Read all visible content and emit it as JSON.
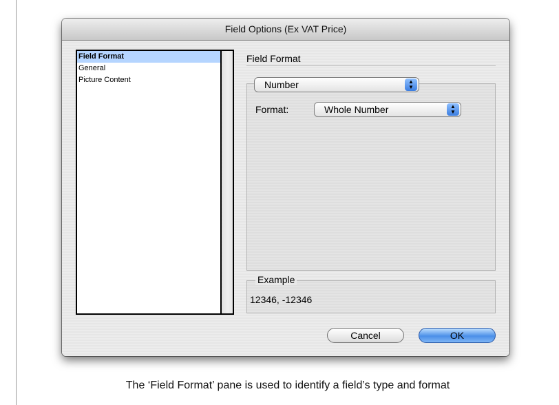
{
  "dialog": {
    "title": "Field Options (Ex VAT Price)"
  },
  "sidebar": {
    "items": [
      {
        "label": "Field Format",
        "selected": true
      },
      {
        "label": "General",
        "selected": false
      },
      {
        "label": "Picture Content",
        "selected": false
      }
    ]
  },
  "pane": {
    "heading": "Field Format",
    "type_popup": "Number",
    "format_label": "Format:",
    "format_popup": "Whole Number",
    "example_legend": "Example",
    "example_value": "12346, -12346"
  },
  "buttons": {
    "cancel": "Cancel",
    "ok": "OK"
  },
  "caption": "The ‘Field Format’ pane is used to identify a field’s type and format",
  "colors": {
    "selection": "#b5d5ff",
    "accent": "#4b8fe8"
  }
}
